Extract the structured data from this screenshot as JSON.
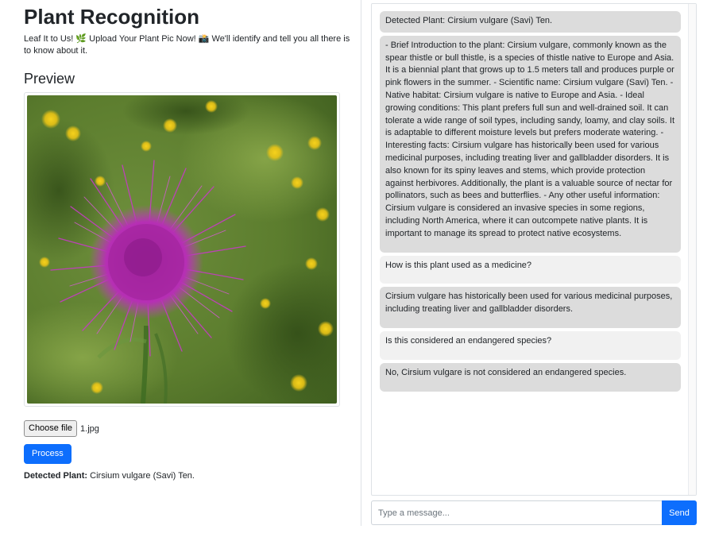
{
  "header": {
    "title": "Plant Recognition",
    "tagline": "Leaf It to Us! 🌿 Upload Your Plant Pic Now! 📸 We'll identify and tell you all there is to know about it."
  },
  "preview": {
    "heading": "Preview",
    "image_subject": "purple thistle flower on green meadow"
  },
  "upload": {
    "choose_label": "Choose file",
    "file_name": "1.jpg",
    "process_label": "Process"
  },
  "result": {
    "label": "Detected Plant:",
    "value": "Cirsium vulgare (Savi) Ten."
  },
  "chat": {
    "messages": [
      {
        "role": "bot",
        "text": "Detected Plant: Cirsium vulgare (Savi) Ten."
      },
      {
        "role": "bot",
        "text": "- Brief Introduction to the plant: Cirsium vulgare, commonly known as the spear thistle or bull thistle, is a species of thistle native to Europe and Asia. It is a biennial plant that grows up to 1.5 meters tall and produces purple or pink flowers in the summer. - Scientific name: Cirsium vulgare (Savi) Ten. - Native habitat: Cirsium vulgare is native to Europe and Asia. - Ideal growing conditions: This plant prefers full sun and well-drained soil. It can tolerate a wide range of soil types, including sandy, loamy, and clay soils. It is adaptable to different moisture levels but prefers moderate watering. - Interesting facts: Cirsium vulgare has historically been used for various medicinal purposes, including treating liver and gallbladder disorders. It is also known for its spiny leaves and stems, which provide protection against herbivores. Additionally, the plant is a valuable source of nectar for pollinators, such as bees and butterflies. - Any other useful information: Cirsium vulgare is considered an invasive species in some regions, including North America, where it can outcompete native plants. It is important to manage its spread to protect native ecosystems."
      },
      {
        "role": "user",
        "text": "How is this plant used as a medicine?"
      },
      {
        "role": "bot",
        "text": "Cirsium vulgare has historically been used for various medicinal purposes, including treating liver and gallbladder disorders."
      },
      {
        "role": "user",
        "text": "Is this considered an endangered species?"
      },
      {
        "role": "bot",
        "text": "No, Cirsium vulgare is not considered an endangered species."
      }
    ],
    "input_placeholder": "Type a message...",
    "send_label": "Send"
  },
  "colors": {
    "primary": "#0d6efd",
    "bot_bubble": "#dcdcdc",
    "user_bubble": "#f1f1f1"
  }
}
